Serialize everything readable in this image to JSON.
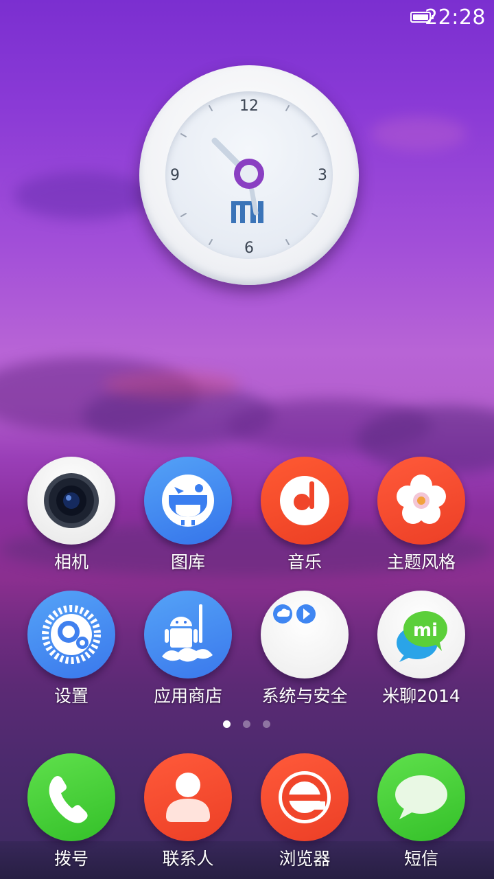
{
  "status_bar": {
    "time": "22:28",
    "battery_level": 1.0
  },
  "clock_widget": {
    "numbers": {
      "twelve": "12",
      "three": "3",
      "six": "6",
      "nine": "9"
    },
    "brand_logo": "MI",
    "time_shown": "10:28"
  },
  "home_grid": {
    "row1": [
      {
        "label": "相机",
        "icon": "camera-icon"
      },
      {
        "label": "图库",
        "icon": "gallery-icon"
      },
      {
        "label": "音乐",
        "icon": "music-icon"
      },
      {
        "label": "主题风格",
        "icon": "theme-icon"
      }
    ],
    "row2": [
      {
        "label": "设置",
        "icon": "settings-icon"
      },
      {
        "label": "应用商店",
        "icon": "app-store-icon"
      },
      {
        "label": "系统与安全",
        "icon": "system-security-folder-icon"
      },
      {
        "label": "米聊2014",
        "icon": "miliao-icon"
      }
    ]
  },
  "page_indicator": {
    "pages": 3,
    "active": 0
  },
  "dock": [
    {
      "label": "拨号",
      "icon": "phone-icon"
    },
    {
      "label": "联系人",
      "icon": "contacts-icon"
    },
    {
      "label": "浏览器",
      "icon": "browser-icon"
    },
    {
      "label": "短信",
      "icon": "messages-icon"
    }
  ],
  "colors": {
    "camera_bg": "#f2f2f2",
    "gallery_bg": "#3f86f2",
    "music_bg": "#f2492a",
    "theme_bg": "#f2462e",
    "settings_bg": "#3f86f2",
    "appstore_bg": "#3f86f2",
    "folder_bg": "#f7f7f7",
    "miliao_bg": "#f7f7f7",
    "phone_bg": "#4bd13d",
    "contacts_bg": "#f2462e",
    "browser_bg": "#f2462e",
    "messages_bg": "#4bd13d"
  }
}
